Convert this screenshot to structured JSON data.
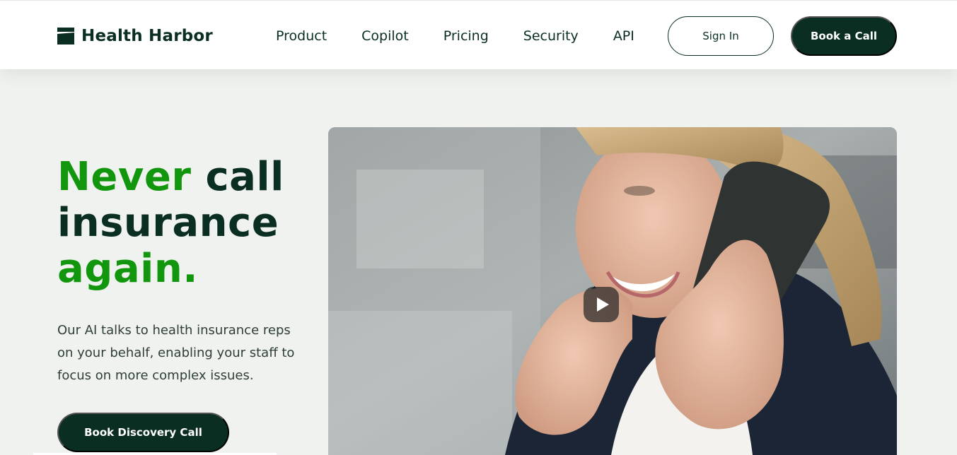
{
  "brand": {
    "name": "Health Harbor",
    "logo_icon": "harbor-logo-mark",
    "color_primary": "#0b2e22",
    "color_accent": "#12960e"
  },
  "nav": {
    "links": [
      "Product",
      "Copilot",
      "Pricing",
      "Security",
      "API"
    ],
    "sign_in": "Sign In",
    "book_call": "Book a Call"
  },
  "hero": {
    "title_part1": "Never",
    "title_part2": " call insurance",
    "title_part3": "again.",
    "subtitle": "Our AI talks to health insurance reps on your behalf, enabling your staff to focus on more complex issues.",
    "cta": "Book Discovery Call",
    "video_icon": "play-icon"
  }
}
